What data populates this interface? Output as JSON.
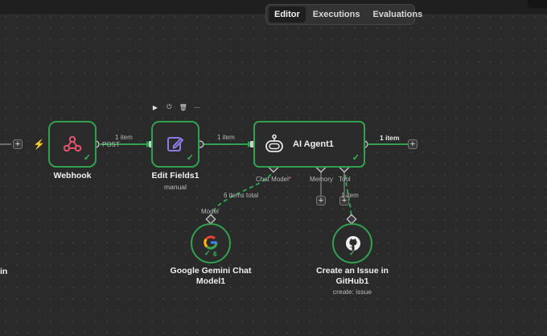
{
  "tabs": [
    "Editor",
    "Executions",
    "Evaluations"
  ],
  "left_cut_label": "in",
  "toolbar": {
    "play": "▶",
    "power": "⏻",
    "delete": "🗑",
    "more": "···"
  },
  "nodes": {
    "webhook": {
      "label": "Webhook",
      "color": "#e4526b"
    },
    "edit_fields": {
      "label": "Edit Fields1",
      "sublabel": "manual",
      "color": "#8b7be8"
    },
    "ai_agent": {
      "label": "AI Agent1"
    },
    "gemini": {
      "label_line1": "Google Gemini Chat",
      "label_line2": "Model1",
      "count": "6"
    },
    "github": {
      "label_line1": "Create an Issue in",
      "label_line2": "GitHub1",
      "sublabel": "create: issue"
    }
  },
  "edges": {
    "webhook_out": "POST",
    "webhook_to_edit": "1 item",
    "edit_to_agent": "1 item",
    "agent_out": "1 item",
    "gemini_items": "6 items total",
    "gemini_port": "Model",
    "github_items": "1 item"
  },
  "ports": {
    "chat_model": "Chat Model",
    "required_mark": "*",
    "memory": "Memory",
    "tool": "Tool"
  },
  "colors": {
    "edge_success": "#30a14e",
    "required": "#ff6b6b",
    "accent_orange": "#f07b2b"
  }
}
